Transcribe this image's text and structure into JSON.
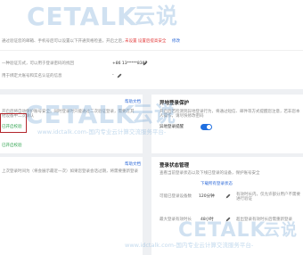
{
  "top_panel": {
    "row1_text": "通过验证您的邮箱、手机号后可以设置以下开通资格检查，开启之后，",
    "row1_red": "未设置 设置后提高安全",
    "row1_link": "修改",
    "row2_text": "一种验证方式，可以用于登录密码的找回",
    "phone_label": "+86 13*****8387",
    "row3_text": "用于绑定大账号和实名认证的信息",
    "row3_value": "-"
  },
  "left_card": {
    "link": "帮助文档",
    "desc": "开启后将自动保护账号安全，同时登录时只能通过二次验证登录，需要在其他设备中二次确认",
    "item1": "已开启校验",
    "item2": "已开启校验"
  },
  "right_card1": {
    "title": "异地登录保护",
    "desc": "开启后若检测到异地登录行为，将通过短信、邮件等方式提醒您注意，若非您本人操作，请尽快修改密码",
    "toggle_label": "异地登录提醒"
  },
  "left_card2": {
    "link": "帮助文档",
    "desc": "上次登录时间为（将会展示最近一次）如果您登录会话过期，将需要重新登录"
  },
  "right_card2": {
    "title": "登录状态管理",
    "desc": "查看当前登录状态以及下线已登录的设备，保护账号安全",
    "link": "下载所有登录状态",
    "item1_label": "可能已登录设备数",
    "item1_value": "120分钟",
    "item1_note": "有效时长内，仅允许部分用户不需要进行验证",
    "item2_label": "最大登录有效时长",
    "item2_value": "48小时",
    "item2_note": "超出登录有效时长后需重新登录"
  },
  "watermarks": {
    "brand_cn": "云说",
    "brand": "CETALK",
    "site": "www.idctalk.com-国内专业云计算交流服务平台-"
  }
}
